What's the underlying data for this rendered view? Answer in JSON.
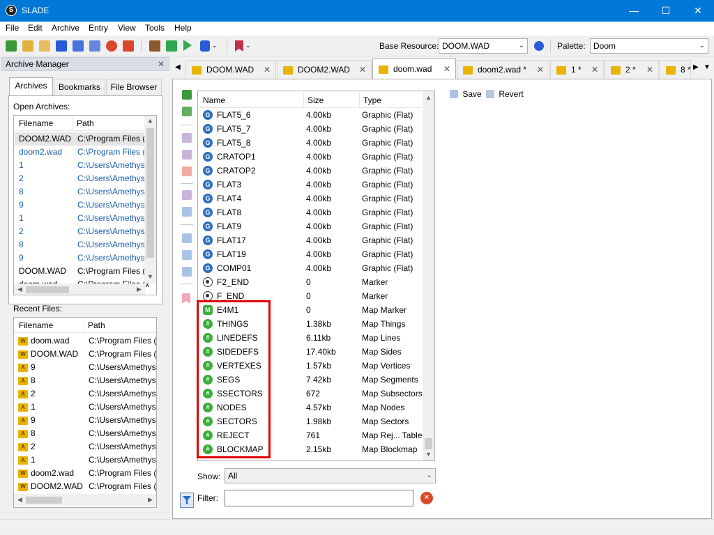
{
  "window": {
    "title": "SLADE",
    "minimize": "—",
    "maximize": "☐",
    "close": "✕"
  },
  "menu": [
    "File",
    "Edit",
    "Archive",
    "Entry",
    "View",
    "Tools",
    "Help"
  ],
  "toolbar": {
    "base_resource_label": "Base Resource:",
    "base_resource_value": "DOOM.WAD",
    "palette_label": "Palette:",
    "palette_value": "Doom"
  },
  "archive_manager": {
    "title": "Archive Manager",
    "tabs": [
      "Archives",
      "Bookmarks",
      "File Browser"
    ],
    "open_archives_label": "Open Archives:",
    "recent_files_label": "Recent Files:",
    "columns": [
      "Filename",
      "Path"
    ],
    "open_archives": [
      {
        "name": "DOOM2.WAD",
        "path": "C:\\Program Files (x",
        "style": "selected"
      },
      {
        "name": "doom2.wad",
        "path": "C:\\Program Files (x",
        "style": "blue"
      },
      {
        "name": "1",
        "path": "C:\\Users\\Amethyst",
        "style": "blue"
      },
      {
        "name": "2",
        "path": "C:\\Users\\Amethyst",
        "style": "blue"
      },
      {
        "name": "8",
        "path": "C:\\Users\\Amethyst",
        "style": "blue"
      },
      {
        "name": "9",
        "path": "C:\\Users\\Amethyst",
        "style": "blue"
      },
      {
        "name": "1",
        "path": "C:\\Users\\Amethyst",
        "style": "blue"
      },
      {
        "name": "2",
        "path": "C:\\Users\\Amethyst",
        "style": "blue"
      },
      {
        "name": "8",
        "path": "C:\\Users\\Amethyst",
        "style": "blue"
      },
      {
        "name": "9",
        "path": "C:\\Users\\Amethyst",
        "style": "blue"
      },
      {
        "name": "DOOM.WAD",
        "path": "C:\\Program Files (x",
        "style": "normal"
      },
      {
        "name": "doom.wad",
        "path": "C:\\Program Files (x",
        "style": "normal"
      }
    ],
    "recent_files": [
      {
        "name": "doom.wad",
        "path": "C:\\Program Files (x",
        "icon": "W"
      },
      {
        "name": "DOOM.WAD",
        "path": "C:\\Program Files (x",
        "icon": "W"
      },
      {
        "name": "9",
        "path": "C:\\Users\\Amethyst",
        "icon": "A"
      },
      {
        "name": "8",
        "path": "C:\\Users\\Amethyst",
        "icon": "A"
      },
      {
        "name": "2",
        "path": "C:\\Users\\Amethyst",
        "icon": "A"
      },
      {
        "name": "1",
        "path": "C:\\Users\\Amethyst",
        "icon": "A"
      },
      {
        "name": "9",
        "path": "C:\\Users\\Amethyst",
        "icon": "A"
      },
      {
        "name": "8",
        "path": "C:\\Users\\Amethyst",
        "icon": "A"
      },
      {
        "name": "2",
        "path": "C:\\Users\\Amethyst",
        "icon": "A"
      },
      {
        "name": "1",
        "path": "C:\\Users\\Amethyst",
        "icon": "A"
      },
      {
        "name": "doom2.wad",
        "path": "C:\\Program Files (x",
        "icon": "W"
      },
      {
        "name": "DOOM2.WAD",
        "path": "C:\\Program Files (x",
        "icon": "W"
      }
    ]
  },
  "doc_tabs": [
    {
      "label": "DOOM.WAD",
      "active": false
    },
    {
      "label": "DOOM2.WAD",
      "active": false
    },
    {
      "label": "doom.wad",
      "active": true
    },
    {
      "label": "doom2.wad *",
      "active": false
    },
    {
      "label": "1 *",
      "active": false
    },
    {
      "label": "2 *",
      "active": false
    },
    {
      "label": "8 *",
      "active": false
    }
  ],
  "entry_list": {
    "columns": [
      "Name",
      "Size",
      "Type"
    ],
    "entries": [
      {
        "name": "FLAT5_6",
        "size": "4.00kb",
        "type": "Graphic (Flat)",
        "icon": "gfx"
      },
      {
        "name": "FLAT5_7",
        "size": "4.00kb",
        "type": "Graphic (Flat)",
        "icon": "gfx"
      },
      {
        "name": "FLAT5_8",
        "size": "4.00kb",
        "type": "Graphic (Flat)",
        "icon": "gfx"
      },
      {
        "name": "CRATOP1",
        "size": "4.00kb",
        "type": "Graphic (Flat)",
        "icon": "gfx"
      },
      {
        "name": "CRATOP2",
        "size": "4.00kb",
        "type": "Graphic (Flat)",
        "icon": "gfx"
      },
      {
        "name": "FLAT3",
        "size": "4.00kb",
        "type": "Graphic (Flat)",
        "icon": "gfx"
      },
      {
        "name": "FLAT4",
        "size": "4.00kb",
        "type": "Graphic (Flat)",
        "icon": "gfx"
      },
      {
        "name": "FLAT8",
        "size": "4.00kb",
        "type": "Graphic (Flat)",
        "icon": "gfx"
      },
      {
        "name": "FLAT9",
        "size": "4.00kb",
        "type": "Graphic (Flat)",
        "icon": "gfx"
      },
      {
        "name": "FLAT17",
        "size": "4.00kb",
        "type": "Graphic (Flat)",
        "icon": "gfx"
      },
      {
        "name": "FLAT19",
        "size": "4.00kb",
        "type": "Graphic (Flat)",
        "icon": "gfx"
      },
      {
        "name": "COMP01",
        "size": "4.00kb",
        "type": "Graphic (Flat)",
        "icon": "gfx"
      },
      {
        "name": "F2_END",
        "size": "0",
        "type": "Marker",
        "icon": "mrk"
      },
      {
        "name": "F_END",
        "size": "0",
        "type": "Marker",
        "icon": "mrk"
      },
      {
        "name": "E4M1",
        "size": "0",
        "type": "Map Marker",
        "icon": "mapm"
      },
      {
        "name": "THINGS",
        "size": "1.38kb",
        "type": "Map Things",
        "icon": "map"
      },
      {
        "name": "LINEDEFS",
        "size": "6.11kb",
        "type": "Map Lines",
        "icon": "map"
      },
      {
        "name": "SIDEDEFS",
        "size": "17.40kb",
        "type": "Map Sides",
        "icon": "map"
      },
      {
        "name": "VERTEXES",
        "size": "1.57kb",
        "type": "Map Vertices",
        "icon": "map"
      },
      {
        "name": "SEGS",
        "size": "7.42kb",
        "type": "Map Segments",
        "icon": "map"
      },
      {
        "name": "SSECTORS",
        "size": "672",
        "type": "Map Subsectors",
        "icon": "map"
      },
      {
        "name": "NODES",
        "size": "4.57kb",
        "type": "Map Nodes",
        "icon": "map"
      },
      {
        "name": "SECTORS",
        "size": "1.98kb",
        "type": "Map Sectors",
        "icon": "map"
      },
      {
        "name": "REJECT",
        "size": "761",
        "type": "Map Rej... Table",
        "icon": "map"
      },
      {
        "name": "BLOCKMAP",
        "size": "2.15kb",
        "type": "Map Blockmap",
        "icon": "map"
      }
    ]
  },
  "show": {
    "label": "Show:",
    "value": "All"
  },
  "filter": {
    "label": "Filter:",
    "value": ""
  },
  "entry_actions": {
    "save": "Save",
    "revert": "Revert"
  },
  "colors": {
    "titlebar": "#0078d7",
    "highlight": "#e00000",
    "link_blue": "#1a5fb4"
  }
}
